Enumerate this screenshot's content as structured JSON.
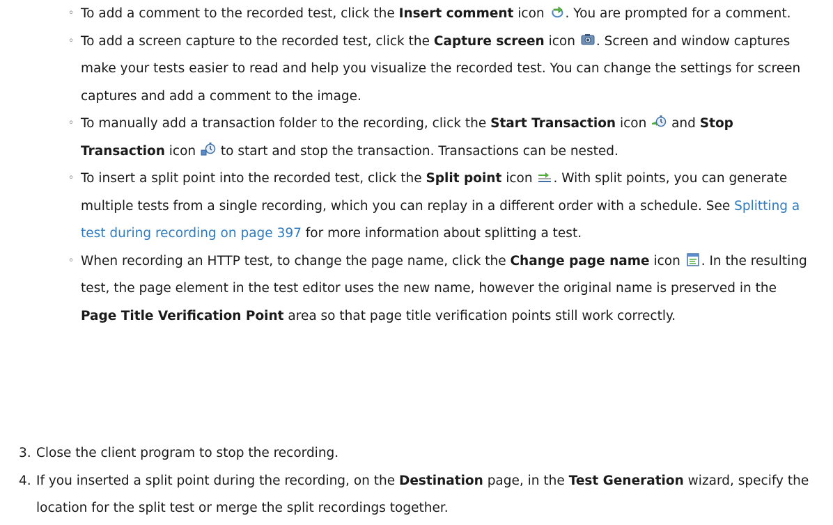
{
  "bullets": [
    {
      "t1": "To add a comment to the recorded test, click the ",
      "b1": "Insert comment",
      "t2": " icon ",
      "t3": ". You are prompted for a comment.",
      "icon": "insert-comment-icon"
    },
    {
      "t1": "To add a screen capture to the recorded test, click the ",
      "b1": "Capture screen",
      "t2": " icon ",
      "t3": ". Screen and window captures make your tests easier to read and help you visualize the recorded test. You can change the settings for screen captures and add a comment to the image.",
      "icon": "capture-screen-icon"
    },
    {
      "t1": "To manually add a transaction folder to the recording, click the ",
      "b1": "Start Transaction",
      "t2": " icon ",
      "t3": " and ",
      "b2": "Stop Transaction",
      "t4": " icon ",
      "t5": " to start and stop the transaction. Transactions can be nested.",
      "icon1": "start-transaction-icon",
      "icon2": "stop-transaction-icon"
    },
    {
      "t1": "To insert a split point into the recorded test, click the ",
      "b1": "Split point",
      "t2": " icon ",
      "t3": ". With split points, you can generate multiple tests from a single recording, which you can replay in a different order with a schedule. See ",
      "link": "Splitting a test during recording on page 397",
      "t4": " for more information about splitting a test.",
      "icon": "split-point-icon"
    },
    {
      "t1": "When recording an HTTP test, to change the page name, click the ",
      "b1": "Change page name",
      "t2": " icon ",
      "t3": ". In the resulting test, the page element in the test editor uses the new name, however the original name is preserved in the ",
      "b2": "Page Title Verification Point",
      "t4": " area so that page title verification points still work correctly.",
      "icon": "change-page-name-icon"
    }
  ],
  "steps": [
    {
      "num": "3.",
      "text": "Close the client program to stop the recording."
    },
    {
      "num": "4.",
      "t1": "If you inserted a split point during the recording, on the ",
      "b1": "Destination",
      "t2": " page, in the ",
      "b2": "Test Generation",
      "t3": " wizard, specify the location for the split test or merge the split recordings together."
    }
  ],
  "colors": {
    "link": "#2f7bc0",
    "text": "#1a1a1a"
  }
}
